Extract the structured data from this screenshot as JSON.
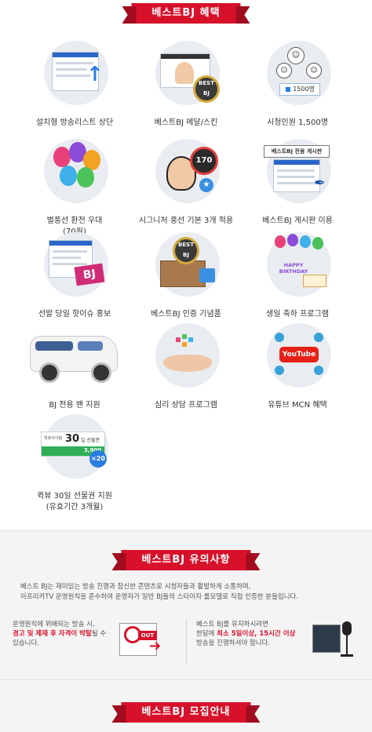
{
  "sections": {
    "benefits_title": "베스트BJ 혜택",
    "notice_title": "베스트BJ 유의사항",
    "recruit_title": "베스트BJ 모집안내"
  },
  "benefits": [
    {
      "label": "설치형 방송리스트 상단"
    },
    {
      "label": "베스트BJ 메달/스킨"
    },
    {
      "label": "시청인원 1,500명"
    },
    {
      "label": "벌풍선 환전 우대",
      "sublabel": "(70원)"
    },
    {
      "label": "시그니처 풍선 기본 3개 적용"
    },
    {
      "label": "베스트BJ 게시판 이용"
    },
    {
      "label": "선발 당일 핫이슈 홍보"
    },
    {
      "label": "베스트BJ 인증 기념품"
    },
    {
      "label": "생일 축하 프로그램"
    },
    {
      "label": "BJ 전용 밴 지원"
    },
    {
      "label": "심리 상담 프로그램"
    },
    {
      "label": "유튜브 MCN 혜택"
    },
    {
      "label": "퀵뷰 30일 선물권 지원",
      "sublabel": "(유효기간 3개월)"
    }
  ],
  "illus_text": {
    "viewer_count": "1500명",
    "best_bj": "BEST BJ",
    "signature_count": "170",
    "board_title": "베스트BJ 전용 게시판",
    "bj_sign": "BJ",
    "happy_birthday": "HAPPY BIRTHDAY",
    "youtube": "YouTube",
    "quickview_label": "퀵뷰아이템",
    "quickview_days": "30",
    "quickview_unit": "일 선물권",
    "quickview_price": "3,900",
    "quickview_multiplier": "×20",
    "out_label": "OUT"
  },
  "notice": {
    "intro_line1": "베스트 BJ는 재미있는 방송 진행과 참신한 콘텐츠로 시청자들과 활발하게 소통하며,",
    "intro_line2": "아프리카TV 운영원칙을 준수하여 운영자가 일반 BJ들의 스타이자 롤모델로 직접 인증한 분들입니다.",
    "left_line1": "운영원칙에 위배되는 방송 시,",
    "left_bold": "경고 및 제재 후 자격이 박탈",
    "left_after": "될 수",
    "left_line3": "있습니다.",
    "right_line1": "베스트 BJ를 유지하시려면",
    "right_pre": "한달에",
    "right_bold": "최소 5일이상, 15시간 이상",
    "right_line3": "방송을 진행하셔야 합니다."
  },
  "colors": {
    "brand_red": "#d8112b",
    "circle_bg": "#e9edf1",
    "accent_blue": "#2a66c9"
  }
}
